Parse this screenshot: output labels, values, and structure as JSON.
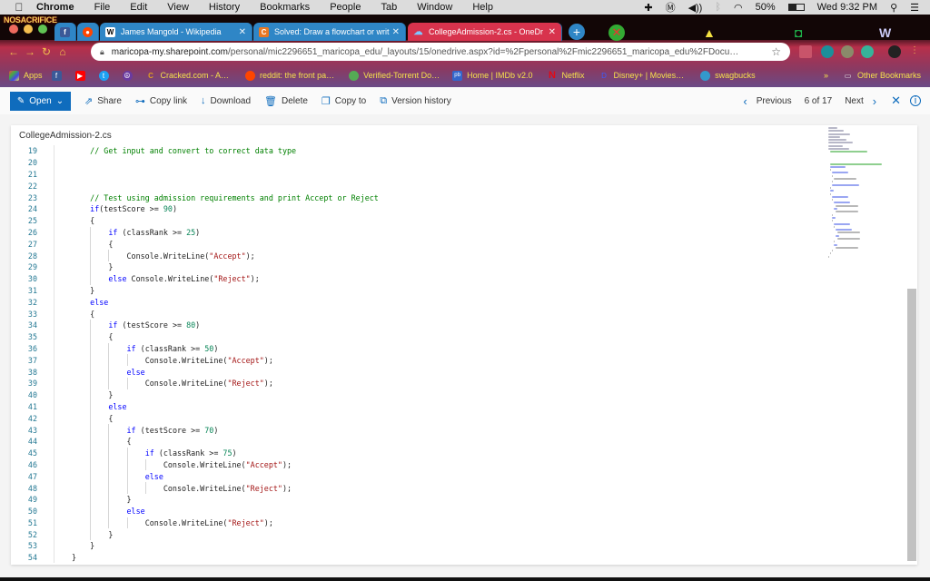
{
  "menubar": {
    "app": "Chrome",
    "items": [
      "File",
      "Edit",
      "View",
      "History",
      "Bookmarks",
      "People",
      "Tab",
      "Window",
      "Help"
    ],
    "battery": "50%",
    "clock": "Wed 9:32 PM"
  },
  "browser": {
    "theme_logo": "NOSACRIFICE",
    "tabs": [
      {
        "label": "James Mangold - Wikipedia",
        "icon": "W"
      },
      {
        "label": "Solved: Draw a flowchart or writ",
        "icon": "C"
      },
      {
        "label": "CollegeAdmission-2.cs - OneDr",
        "icon": "☁"
      }
    ],
    "url_host": "maricopa-my.sharepoint.com",
    "url_rest": "/personal/mic2296651_maricopa_edu/_layouts/15/onedrive.aspx?id=%2Fpersonal%2Fmic2296651_maricopa_edu%2FDocu…",
    "bookmarks": [
      {
        "label": "Apps",
        "color": "#e44"
      },
      {
        "label": "",
        "color": "#3b5998",
        "icon": "f"
      },
      {
        "label": "",
        "color": "#f00",
        "icon": "▶"
      },
      {
        "label": "",
        "color": "#1da1f2",
        "icon": "t"
      },
      {
        "label": "",
        "color": "#6a3aa0",
        "icon": "☮"
      },
      {
        "label": "Cracked.com - A…",
        "color": "#e0a020",
        "icon": "C"
      },
      {
        "label": "reddit: the front pa…",
        "color": "#ff4500",
        "icon": "●"
      },
      {
        "label": "Verified-Torrent Do…",
        "color": "#5a5",
        "icon": "●"
      },
      {
        "label": "Home | IMDb v2.0",
        "color": "#36c",
        "icon": "pb"
      },
      {
        "label": "Netflix",
        "color": "#e50914",
        "icon": "N"
      },
      {
        "label": "Disney+ | Movies…",
        "color": "#113ccf",
        "icon": "D"
      },
      {
        "label": "swagbucks",
        "color": "#39c",
        "icon": "S"
      }
    ],
    "other_bookmarks": "Other Bookmarks"
  },
  "commandbar": {
    "open": "Open",
    "share": "Share",
    "copy_link": "Copy link",
    "download": "Download",
    "delete": "Delete",
    "copy_to": "Copy to",
    "version_history": "Version history",
    "previous": "Previous",
    "position": "6 of 17",
    "next": "Next"
  },
  "file": {
    "name": "CollegeAdmission-2.cs",
    "lines": [
      {
        "n": "19",
        "indent": 1,
        "tokens": [
          [
            "cm",
            "// Get input and convert to correct data type"
          ]
        ]
      },
      {
        "n": "20",
        "indent": 0,
        "tokens": []
      },
      {
        "n": "21",
        "indent": 0,
        "tokens": []
      },
      {
        "n": "22",
        "indent": 0,
        "tokens": []
      },
      {
        "n": "23",
        "indent": 1,
        "tokens": [
          [
            "cm",
            "// Test using admission requirements and print Accept or Reject"
          ]
        ]
      },
      {
        "n": "24",
        "indent": 1,
        "tokens": [
          [
            "kw",
            "if"
          ],
          [
            "",
            "(testScore >= "
          ],
          [
            "nm",
            "90"
          ],
          [
            "",
            ")"
          ]
        ]
      },
      {
        "n": "25",
        "indent": 1,
        "tokens": [
          [
            "",
            "{"
          ]
        ]
      },
      {
        "n": "26",
        "indent": 2,
        "tokens": [
          [
            "kw",
            "if"
          ],
          [
            "",
            " (classRank >= "
          ],
          [
            "nm",
            "25"
          ],
          [
            "",
            ")"
          ]
        ]
      },
      {
        "n": "27",
        "indent": 2,
        "tokens": [
          [
            "",
            "{"
          ]
        ]
      },
      {
        "n": "28",
        "indent": 3,
        "tokens": [
          [
            "",
            "Console.WriteLine("
          ],
          [
            "st",
            "\"Accept\""
          ],
          [
            "",
            ");"
          ]
        ]
      },
      {
        "n": "29",
        "indent": 2,
        "tokens": [
          [
            "",
            "}"
          ]
        ]
      },
      {
        "n": "30",
        "indent": 2,
        "tokens": [
          [
            "kw",
            "else"
          ],
          [
            "",
            " Console.WriteLine("
          ],
          [
            "st",
            "\"Reject\""
          ],
          [
            "",
            ");"
          ]
        ]
      },
      {
        "n": "31",
        "indent": 1,
        "tokens": [
          [
            "",
            "}"
          ]
        ]
      },
      {
        "n": "32",
        "indent": 1,
        "tokens": [
          [
            "kw",
            "else"
          ]
        ]
      },
      {
        "n": "33",
        "indent": 1,
        "tokens": [
          [
            "",
            "{"
          ]
        ]
      },
      {
        "n": "34",
        "indent": 2,
        "tokens": [
          [
            "kw",
            "if"
          ],
          [
            "",
            " (testScore >= "
          ],
          [
            "nm",
            "80"
          ],
          [
            "",
            ")"
          ]
        ]
      },
      {
        "n": "35",
        "indent": 2,
        "tokens": [
          [
            "",
            "{"
          ]
        ]
      },
      {
        "n": "36",
        "indent": 3,
        "tokens": [
          [
            "kw",
            "if"
          ],
          [
            "",
            " (classRank >= "
          ],
          [
            "nm",
            "50"
          ],
          [
            "",
            ")"
          ]
        ]
      },
      {
        "n": "37",
        "indent": 4,
        "tokens": [
          [
            "",
            "Console.WriteLine("
          ],
          [
            "st",
            "\"Accept\""
          ],
          [
            "",
            ");"
          ]
        ]
      },
      {
        "n": "38",
        "indent": 3,
        "tokens": [
          [
            "kw",
            "else"
          ]
        ]
      },
      {
        "n": "39",
        "indent": 4,
        "tokens": [
          [
            "",
            "Console.WriteLine("
          ],
          [
            "st",
            "\"Reject\""
          ],
          [
            "",
            ");"
          ]
        ]
      },
      {
        "n": "40",
        "indent": 2,
        "tokens": [
          [
            "",
            "}"
          ]
        ]
      },
      {
        "n": "41",
        "indent": 2,
        "tokens": [
          [
            "kw",
            "else"
          ]
        ]
      },
      {
        "n": "42",
        "indent": 2,
        "tokens": [
          [
            "",
            "{"
          ]
        ]
      },
      {
        "n": "43",
        "indent": 3,
        "tokens": [
          [
            "kw",
            "if"
          ],
          [
            "",
            " (testScore >= "
          ],
          [
            "nm",
            "70"
          ],
          [
            "",
            ")"
          ]
        ]
      },
      {
        "n": "44",
        "indent": 3,
        "tokens": [
          [
            "",
            "{"
          ]
        ]
      },
      {
        "n": "45",
        "indent": 4,
        "tokens": [
          [
            "kw",
            "if"
          ],
          [
            "",
            " (classRank >= "
          ],
          [
            "nm",
            "75"
          ],
          [
            "",
            ")"
          ]
        ]
      },
      {
        "n": "46",
        "indent": 5,
        "tokens": [
          [
            "",
            "Console.WriteLine("
          ],
          [
            "st",
            "\"Accept\""
          ],
          [
            "",
            ");"
          ]
        ]
      },
      {
        "n": "47",
        "indent": 4,
        "tokens": [
          [
            "kw",
            "else"
          ]
        ]
      },
      {
        "n": "48",
        "indent": 5,
        "tokens": [
          [
            "",
            "Console.WriteLine("
          ],
          [
            "st",
            "\"Reject\""
          ],
          [
            "",
            ");"
          ]
        ]
      },
      {
        "n": "49",
        "indent": 3,
        "tokens": [
          [
            "",
            "}"
          ]
        ]
      },
      {
        "n": "50",
        "indent": 3,
        "tokens": [
          [
            "kw",
            "else"
          ]
        ]
      },
      {
        "n": "51",
        "indent": 4,
        "tokens": [
          [
            "",
            "Console.WriteLine("
          ],
          [
            "st",
            "\"Reject\""
          ],
          [
            "",
            ");"
          ]
        ]
      },
      {
        "n": "52",
        "indent": 2,
        "tokens": [
          [
            "",
            "}"
          ]
        ]
      },
      {
        "n": "53",
        "indent": 1,
        "tokens": [
          [
            "",
            "}"
          ]
        ]
      },
      {
        "n": "54",
        "indent": 0,
        "tokens": [
          [
            "",
            "}"
          ]
        ]
      }
    ]
  }
}
